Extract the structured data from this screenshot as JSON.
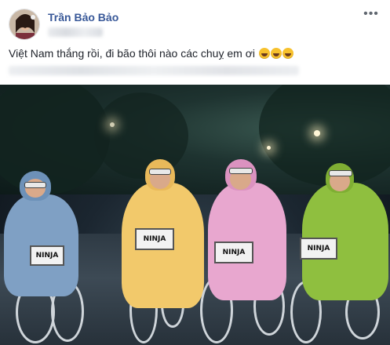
{
  "post": {
    "author": "Trần Bảo Bảo",
    "text": "Việt Nam thắng rồi, đi bão thôi nào các chuỵ em ơi",
    "emojis": [
      "rofl-emoji",
      "rofl-emoji",
      "rofl-emoji"
    ],
    "more_icon": "more-horizontal-icon"
  },
  "photo": {
    "signs": [
      "NINJA",
      "NINJA",
      "NINJA",
      "NINJA"
    ],
    "colors": {
      "rider1": "#7fa0c4",
      "rider2": "#f2c96b",
      "rider3": "#e8a7cf",
      "rider4": "#8fbf3f"
    }
  }
}
